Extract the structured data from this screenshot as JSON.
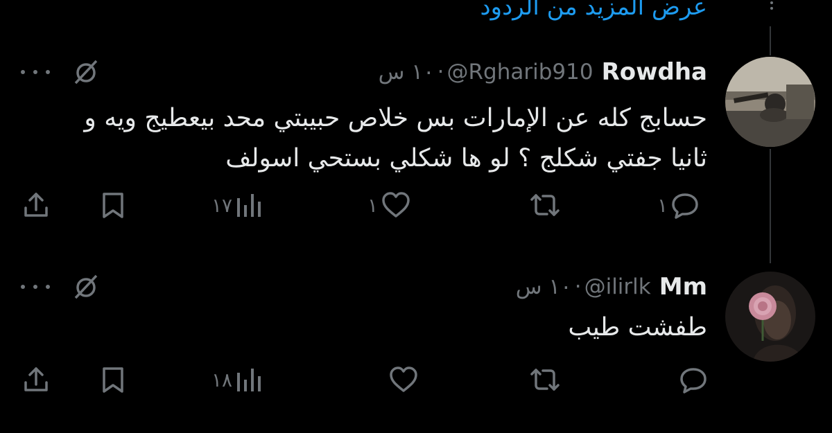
{
  "thread": {
    "show_more_replies": "عرض المزيد من الردود"
  },
  "tweets": [
    {
      "name": "Rowdha",
      "handle": "@Rgharib910",
      "separator": "·",
      "time": "١٠ س",
      "text": "حسابج كله عن الإمارات بس خلاص حبيبتي محد بيعطيج ويه و ثانيا جفتي شكلج ؟ لو ها شكلي بستحي اسولف",
      "replies": "١",
      "reposts": "",
      "likes": "١",
      "views": "١٧"
    },
    {
      "name": "Mm",
      "handle": "@ilirlk",
      "separator": "·",
      "time": "١٠ س",
      "text": "طفشت طيب",
      "replies": "",
      "reposts": "",
      "likes": "",
      "views": "١٨"
    }
  ],
  "icons": {
    "reply": "reply-icon",
    "repost": "repost-icon",
    "like": "like-icon",
    "views": "views-icon",
    "bookmark": "bookmark-icon",
    "share": "share-icon",
    "grok": "grok-icon",
    "more": "more-icon"
  },
  "colors": {
    "background": "#000000",
    "text": "#e7e9ea",
    "secondary": "#71767b",
    "accent": "#1d9bf0",
    "thread_line": "#333639"
  }
}
